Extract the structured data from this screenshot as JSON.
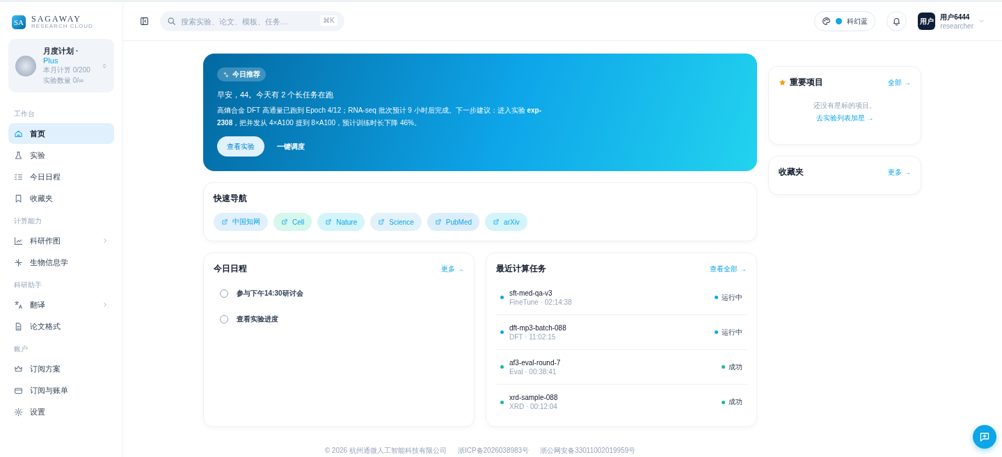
{
  "brand": {
    "mark": "SA",
    "name": "SAGAWAY",
    "tagline": "RESEARCH CLOUD"
  },
  "plan": {
    "title": "月度计划",
    "separator": "·",
    "tier": "Plus",
    "lines": [
      "本月计算 0/200",
      "实验数量 0/∞"
    ]
  },
  "sidebar": {
    "groups": [
      {
        "label": "工作台",
        "items": [
          {
            "label": "首页",
            "selected": true,
            "has_submenu": false
          },
          {
            "label": "实验",
            "selected": false,
            "has_submenu": false
          },
          {
            "label": "今日日程",
            "selected": false,
            "has_submenu": false
          },
          {
            "label": "收藏夹",
            "selected": false,
            "has_submenu": false
          }
        ]
      },
      {
        "label": "计算能力",
        "items": [
          {
            "label": "科研作图",
            "selected": false,
            "has_submenu": true
          },
          {
            "label": "生物信息学",
            "selected": false,
            "has_submenu": false
          }
        ]
      },
      {
        "label": "科研助手",
        "items": [
          {
            "label": "翻译",
            "selected": false,
            "has_submenu": true
          },
          {
            "label": "论文格式",
            "selected": false,
            "has_submenu": false
          }
        ]
      },
      {
        "label": "账户",
        "items": [
          {
            "label": "订阅方案",
            "selected": false,
            "has_submenu": false
          },
          {
            "label": "订阅与账单",
            "selected": false,
            "has_submenu": false
          },
          {
            "label": "设置",
            "selected": false,
            "has_submenu": false
          }
        ]
      }
    ]
  },
  "header": {
    "search": {
      "placeholder": "搜索实验、论文、模板、任务…",
      "shortcut": "⌘K"
    },
    "theme": {
      "label": "科幻蓝",
      "color": "#0ea5e9"
    },
    "user": {
      "avatar": "用户",
      "name": "用户6444",
      "role": "researcher"
    }
  },
  "hero": {
    "badge": "今日推荐",
    "greeting": "早安，44。今天有 2 个长任务在跑",
    "body": "高熵合金 DFT 高通量已跑到 Epoch 4/12；RNA-seq 批次预计 9 小时后完成。下一步建议：进入实验 **exp-2308**，把并发从 4×A100 提到 8×A100，预计训练时长下降 46%。",
    "buttons": [
      {
        "label": "查看实验",
        "kind": "primary"
      },
      {
        "label": "一键调度",
        "kind": "ghost"
      }
    ]
  },
  "quick_nav": {
    "title": "快速导航",
    "links": [
      {
        "label": "中国知网",
        "color": "#e0f0fc"
      },
      {
        "label": "Cell",
        "color": "#d5f7ec"
      },
      {
        "label": "Nature",
        "color": "#d3f4fa"
      },
      {
        "label": "Science",
        "color": "#e3f1fa"
      },
      {
        "label": "PubMed",
        "color": "#dceefb"
      },
      {
        "label": "arXiv",
        "color": "#d3f4fa"
      }
    ]
  },
  "schedule": {
    "title": "今日日程",
    "more": "更多 →",
    "items": [
      {
        "label": "参与下午14:30研讨会",
        "checked": false
      },
      {
        "label": "查看实验进度",
        "checked": false
      }
    ]
  },
  "tasks": {
    "title": "最近计算任务",
    "more": "查看全部 →",
    "items": [
      {
        "name": "sft-med-qa-v3",
        "meta": "FineTune · 02:14:38",
        "status": "运行中",
        "color": "#0ea5e9"
      },
      {
        "name": "dft-mp3-batch-088",
        "meta": "DFT · 11:02:15",
        "status": "运行中",
        "color": "#0ea5e9"
      },
      {
        "name": "af3-eval-round-7",
        "meta": "Eval · 00:38:41",
        "status": "成功",
        "color": "#14b8a6"
      },
      {
        "name": "xrd-sample-088",
        "meta": "XRD · 00:12:04",
        "status": "成功",
        "color": "#14b8a6"
      }
    ]
  },
  "starred": {
    "title": "重要项目",
    "more": "全部 →",
    "empty": "还没有星标的项目。",
    "empty_link": "去实验列表加星 →"
  },
  "favorites": {
    "title": "收藏夹",
    "more": "更多 →"
  },
  "footer": [
    "© 2026 杭州通微人工智能科技有限公司",
    "浙ICP备2026038983号",
    "浙公网安备33011002019959号"
  ]
}
